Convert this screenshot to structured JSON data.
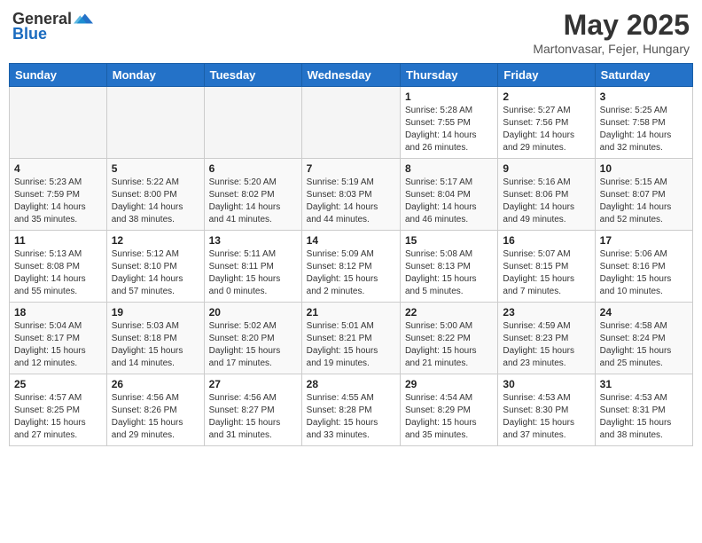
{
  "header": {
    "logo_general": "General",
    "logo_blue": "Blue",
    "month_title": "May 2025",
    "location": "Martonvasar, Fejer, Hungary"
  },
  "days_of_week": [
    "Sunday",
    "Monday",
    "Tuesday",
    "Wednesday",
    "Thursday",
    "Friday",
    "Saturday"
  ],
  "weeks": [
    [
      {
        "day": "",
        "info": ""
      },
      {
        "day": "",
        "info": ""
      },
      {
        "day": "",
        "info": ""
      },
      {
        "day": "",
        "info": ""
      },
      {
        "day": "1",
        "info": "Sunrise: 5:28 AM\nSunset: 7:55 PM\nDaylight: 14 hours\nand 26 minutes."
      },
      {
        "day": "2",
        "info": "Sunrise: 5:27 AM\nSunset: 7:56 PM\nDaylight: 14 hours\nand 29 minutes."
      },
      {
        "day": "3",
        "info": "Sunrise: 5:25 AM\nSunset: 7:58 PM\nDaylight: 14 hours\nand 32 minutes."
      }
    ],
    [
      {
        "day": "4",
        "info": "Sunrise: 5:23 AM\nSunset: 7:59 PM\nDaylight: 14 hours\nand 35 minutes."
      },
      {
        "day": "5",
        "info": "Sunrise: 5:22 AM\nSunset: 8:00 PM\nDaylight: 14 hours\nand 38 minutes."
      },
      {
        "day": "6",
        "info": "Sunrise: 5:20 AM\nSunset: 8:02 PM\nDaylight: 14 hours\nand 41 minutes."
      },
      {
        "day": "7",
        "info": "Sunrise: 5:19 AM\nSunset: 8:03 PM\nDaylight: 14 hours\nand 44 minutes."
      },
      {
        "day": "8",
        "info": "Sunrise: 5:17 AM\nSunset: 8:04 PM\nDaylight: 14 hours\nand 46 minutes."
      },
      {
        "day": "9",
        "info": "Sunrise: 5:16 AM\nSunset: 8:06 PM\nDaylight: 14 hours\nand 49 minutes."
      },
      {
        "day": "10",
        "info": "Sunrise: 5:15 AM\nSunset: 8:07 PM\nDaylight: 14 hours\nand 52 minutes."
      }
    ],
    [
      {
        "day": "11",
        "info": "Sunrise: 5:13 AM\nSunset: 8:08 PM\nDaylight: 14 hours\nand 55 minutes."
      },
      {
        "day": "12",
        "info": "Sunrise: 5:12 AM\nSunset: 8:10 PM\nDaylight: 14 hours\nand 57 minutes."
      },
      {
        "day": "13",
        "info": "Sunrise: 5:11 AM\nSunset: 8:11 PM\nDaylight: 15 hours\nand 0 minutes."
      },
      {
        "day": "14",
        "info": "Sunrise: 5:09 AM\nSunset: 8:12 PM\nDaylight: 15 hours\nand 2 minutes."
      },
      {
        "day": "15",
        "info": "Sunrise: 5:08 AM\nSunset: 8:13 PM\nDaylight: 15 hours\nand 5 minutes."
      },
      {
        "day": "16",
        "info": "Sunrise: 5:07 AM\nSunset: 8:15 PM\nDaylight: 15 hours\nand 7 minutes."
      },
      {
        "day": "17",
        "info": "Sunrise: 5:06 AM\nSunset: 8:16 PM\nDaylight: 15 hours\nand 10 minutes."
      }
    ],
    [
      {
        "day": "18",
        "info": "Sunrise: 5:04 AM\nSunset: 8:17 PM\nDaylight: 15 hours\nand 12 minutes."
      },
      {
        "day": "19",
        "info": "Sunrise: 5:03 AM\nSunset: 8:18 PM\nDaylight: 15 hours\nand 14 minutes."
      },
      {
        "day": "20",
        "info": "Sunrise: 5:02 AM\nSunset: 8:20 PM\nDaylight: 15 hours\nand 17 minutes."
      },
      {
        "day": "21",
        "info": "Sunrise: 5:01 AM\nSunset: 8:21 PM\nDaylight: 15 hours\nand 19 minutes."
      },
      {
        "day": "22",
        "info": "Sunrise: 5:00 AM\nSunset: 8:22 PM\nDaylight: 15 hours\nand 21 minutes."
      },
      {
        "day": "23",
        "info": "Sunrise: 4:59 AM\nSunset: 8:23 PM\nDaylight: 15 hours\nand 23 minutes."
      },
      {
        "day": "24",
        "info": "Sunrise: 4:58 AM\nSunset: 8:24 PM\nDaylight: 15 hours\nand 25 minutes."
      }
    ],
    [
      {
        "day": "25",
        "info": "Sunrise: 4:57 AM\nSunset: 8:25 PM\nDaylight: 15 hours\nand 27 minutes."
      },
      {
        "day": "26",
        "info": "Sunrise: 4:56 AM\nSunset: 8:26 PM\nDaylight: 15 hours\nand 29 minutes."
      },
      {
        "day": "27",
        "info": "Sunrise: 4:56 AM\nSunset: 8:27 PM\nDaylight: 15 hours\nand 31 minutes."
      },
      {
        "day": "28",
        "info": "Sunrise: 4:55 AM\nSunset: 8:28 PM\nDaylight: 15 hours\nand 33 minutes."
      },
      {
        "day": "29",
        "info": "Sunrise: 4:54 AM\nSunset: 8:29 PM\nDaylight: 15 hours\nand 35 minutes."
      },
      {
        "day": "30",
        "info": "Sunrise: 4:53 AM\nSunset: 8:30 PM\nDaylight: 15 hours\nand 37 minutes."
      },
      {
        "day": "31",
        "info": "Sunrise: 4:53 AM\nSunset: 8:31 PM\nDaylight: 15 hours\nand 38 minutes."
      }
    ]
  ]
}
